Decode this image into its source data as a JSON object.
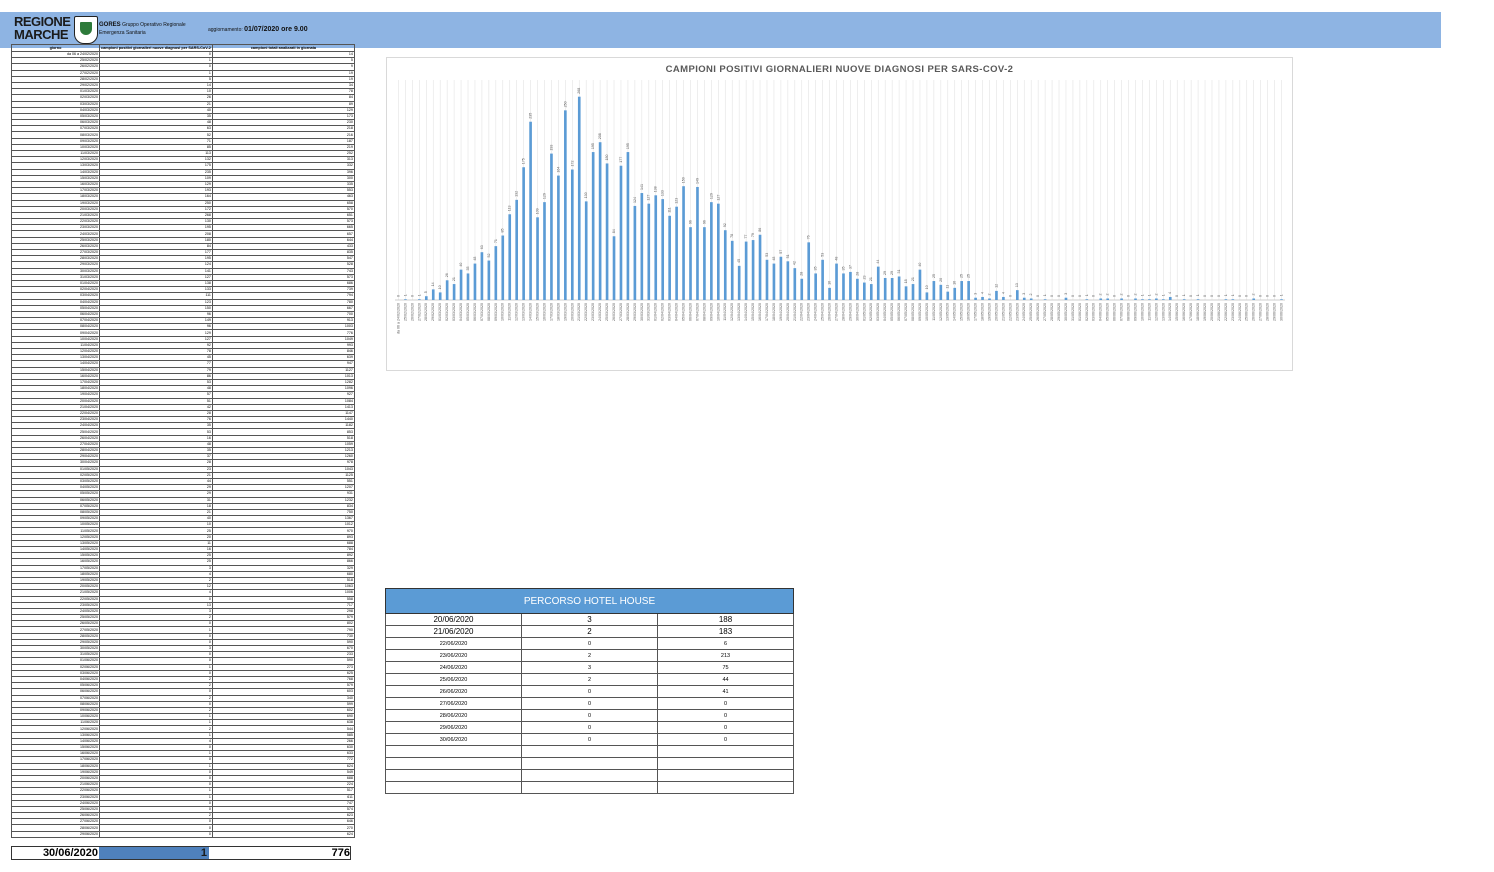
{
  "header": {
    "logo_line1": "REGIONE",
    "logo_line2": "MARCHE",
    "org_name": "GORES",
    "org_desc1": "Gruppo Operativo Regionale",
    "org_desc2": "Emergenza Sanitaria",
    "update_label": "aggiornamento:",
    "update_value": "01/07/2020 ore 9.00"
  },
  "data_table": {
    "columns": [
      "giorno",
      "campioni positivi giornalieri nuove diagnosi per SARS-CoV-2",
      "campioni totali analizzati in giornata"
    ],
    "rows": [
      [
        "da 06 a 24/02/2020",
        "0",
        "14"
      ],
      [
        "25/02/2020",
        "1",
        "5"
      ],
      [
        "26/02/2020",
        "0",
        "9"
      ],
      [
        "27/02/2020",
        "1",
        "19"
      ],
      [
        "28/02/2020",
        "5",
        "19"
      ],
      [
        "29/02/2020",
        "14",
        "34"
      ],
      [
        "01/03/2020",
        "10",
        "78"
      ],
      [
        "02/03/2020",
        "26",
        "84"
      ],
      [
        "03/03/2020",
        "21",
        "89"
      ],
      [
        "04/03/2020",
        "40",
        "129"
      ],
      [
        "05/03/2020",
        "35",
        "173"
      ],
      [
        "06/03/2020",
        "48",
        "230"
      ],
      [
        "07/03/2020",
        "63",
        "218"
      ],
      [
        "08/03/2020",
        "52",
        "216"
      ],
      [
        "09/03/2020",
        "71",
        "187"
      ],
      [
        "10/03/2020",
        "85",
        "219"
      ],
      [
        "11/03/2020",
        "113",
        "252"
      ],
      [
        "12/03/2020",
        "132",
        "313"
      ],
      [
        "13/03/2020",
        "175",
        "332"
      ],
      [
        "14/03/2020",
        "235",
        "396"
      ],
      [
        "15/03/2020",
        "109",
        "300"
      ],
      [
        "16/03/2020",
        "129",
        "335"
      ],
      [
        "17/03/2020",
        "193",
        "553"
      ],
      [
        "18/03/2020",
        "164",
        "463"
      ],
      [
        "19/03/2020",
        "250",
        "658"
      ],
      [
        "20/03/2020",
        "172",
        "570"
      ],
      [
        "21/03/2020",
        "268",
        "651"
      ],
      [
        "22/03/2020",
        "130",
        "573"
      ],
      [
        "23/03/2020",
        "195",
        "665"
      ],
      [
        "24/03/2020",
        "208",
        "657"
      ],
      [
        "25/03/2020",
        "180",
        "644"
      ],
      [
        "26/03/2020",
        "84",
        "433"
      ],
      [
        "27/03/2020",
        "177",
        "835"
      ],
      [
        "28/03/2020",
        "195",
        "547"
      ],
      [
        "29/03/2020",
        "124",
        "528"
      ],
      [
        "30/03/2020",
        "141",
        "743"
      ],
      [
        "31/03/2020",
        "127",
        "573"
      ],
      [
        "01/04/2020",
        "138",
        "686"
      ],
      [
        "02/04/2020",
        "133",
        "739"
      ],
      [
        "03/04/2020",
        "111",
        "794"
      ],
      [
        "04/04/2020",
        "123",
        "780"
      ],
      [
        "05/04/2020",
        "150",
        "667"
      ],
      [
        "06/04/2020",
        "96",
        "700"
      ],
      [
        "07/04/2020",
        "149",
        "913"
      ],
      [
        "08/04/2020",
        "96",
        "1003"
      ],
      [
        "09/04/2020",
        "129",
        "776"
      ],
      [
        "10/04/2020",
        "127",
        "1049"
      ],
      [
        "11/04/2020",
        "92",
        "993"
      ],
      [
        "12/04/2020",
        "78",
        "846"
      ],
      [
        "13/04/2020",
        "45",
        "639"
      ],
      [
        "14/04/2020",
        "77",
        "947"
      ],
      [
        "15/04/2020",
        "79",
        "1127"
      ],
      [
        "16/04/2020",
        "86",
        "1013"
      ],
      [
        "17/04/2020",
        "53",
        "1282"
      ],
      [
        "18/04/2020",
        "48",
        "1096"
      ],
      [
        "19/04/2020",
        "57",
        "927"
      ],
      [
        "20/04/2020",
        "51",
        "1084"
      ],
      [
        "21/04/2020",
        "42",
        "1413"
      ],
      [
        "22/04/2020",
        "28",
        "1147"
      ],
      [
        "23/04/2020",
        "76",
        "1440"
      ],
      [
        "24/04/2020",
        "35",
        "1182"
      ],
      [
        "25/04/2020",
        "53",
        "853"
      ],
      [
        "26/04/2020",
        "16",
        "518"
      ],
      [
        "27/04/2020",
        "48",
        "1059"
      ],
      [
        "28/04/2020",
        "35",
        "1213"
      ],
      [
        "29/04/2020",
        "37",
        "1260"
      ],
      [
        "30/04/2020",
        "28",
        "978"
      ],
      [
        "01/05/2020",
        "23",
        "1043"
      ],
      [
        "02/05/2020",
        "21",
        "1125"
      ],
      [
        "03/05/2020",
        "44",
        "551"
      ],
      [
        "04/05/2020",
        "29",
        "1207"
      ],
      [
        "05/05/2020",
        "29",
        "931"
      ],
      [
        "06/05/2020",
        "31",
        "1232"
      ],
      [
        "07/05/2020",
        "18",
        "834"
      ],
      [
        "08/05/2020",
        "21",
        "750"
      ],
      [
        "09/05/2020",
        "40",
        "1367"
      ],
      [
        "10/05/2020",
        "10",
        "1012"
      ],
      [
        "11/05/2020",
        "25",
        "970"
      ],
      [
        "12/05/2020",
        "20",
        "893"
      ],
      [
        "13/05/2020",
        "11",
        "688"
      ],
      [
        "14/05/2020",
        "16",
        "784"
      ],
      [
        "15/05/2020",
        "25",
        "892"
      ],
      [
        "16/05/2020",
        "25",
        "866"
      ],
      [
        "17/05/2020",
        "3",
        "329"
      ],
      [
        "18/05/2020",
        "4",
        "680"
      ],
      [
        "19/05/2020",
        "2",
        "518"
      ],
      [
        "20/05/2020",
        "12",
        "1063"
      ],
      [
        "21/05/2020",
        "4",
        "1006"
      ],
      [
        "22/05/2020",
        "0",
        "558"
      ],
      [
        "23/05/2020",
        "13",
        "717"
      ],
      [
        "24/05/2020",
        "3",
        "298"
      ],
      [
        "25/05/2020",
        "2",
        "579"
      ],
      [
        "26/05/2020",
        "0",
        "802"
      ],
      [
        "27/05/2020",
        "1",
        "790"
      ],
      [
        "28/05/2020",
        "0",
        "730"
      ],
      [
        "29/05/2020",
        "0",
        "590"
      ],
      [
        "30/05/2020",
        "3",
        "670"
      ],
      [
        "31/05/2020",
        "0",
        "233"
      ],
      [
        "01/06/2020",
        "0",
        "590"
      ],
      [
        "02/06/2020",
        "1",
        "273"
      ],
      [
        "03/06/2020",
        "0",
        "625"
      ],
      [
        "04/06/2020",
        "2",
        "768"
      ],
      [
        "05/06/2020",
        "2",
        "579"
      ],
      [
        "06/06/2020",
        "0",
        "603"
      ],
      [
        "07/06/2020",
        "2",
        "340"
      ],
      [
        "08/06/2020",
        "0",
        "599"
      ],
      [
        "09/06/2020",
        "2",
        "602"
      ],
      [
        "10/06/2020",
        "1",
        "690"
      ],
      [
        "11/06/2020",
        "1",
        "638"
      ],
      [
        "12/06/2020",
        "2",
        "544"
      ],
      [
        "13/06/2020",
        "1",
        "585"
      ],
      [
        "14/06/2020",
        "4",
        "266"
      ],
      [
        "15/06/2020",
        "0",
        "630"
      ],
      [
        "16/06/2020",
        "1",
        "633"
      ],
      [
        "17/06/2020",
        "0",
        "772"
      ],
      [
        "18/06/2020",
        "1",
        "624"
      ],
      [
        "19/06/2020",
        "0",
        "549"
      ],
      [
        "20/06/2020",
        "0",
        "688"
      ],
      [
        "21/06/2020",
        "0",
        "224"
      ],
      [
        "22/06/2020",
        "1",
        "517"
      ],
      [
        "23/06/2020",
        "1",
        "611"
      ],
      [
        "24/06/2020",
        "0",
        "747"
      ],
      [
        "25/06/2020",
        "0",
        "574"
      ],
      [
        "26/06/2020",
        "2",
        "623"
      ],
      [
        "27/06/2020",
        "0",
        "646"
      ],
      [
        "28/06/2020",
        "0",
        "270"
      ],
      [
        "29/06/2020",
        "0",
        "624"
      ]
    ],
    "total": {
      "date": "30/06/2020",
      "cases": "1",
      "tests": "776"
    }
  },
  "chart_data": {
    "type": "bar",
    "title": "CAMPIONI POSITIVI GIORNALIERI NUOVE DIAGNOSI PER SARS-COV-2",
    "xlabel": "",
    "ylabel": "",
    "ylim": [
      0,
      290
    ],
    "grid": true,
    "bar_color": "#5b9bd5",
    "gridline_color": "#e3e3e3",
    "categories": [
      "da 06 a 24/02/2020",
      "25/02/2020",
      "26/02/2020",
      "27/02/2020",
      "28/02/2020",
      "29/02/2020",
      "01/03/2020",
      "02/03/2020",
      "03/03/2020",
      "04/03/2020",
      "05/03/2020",
      "06/03/2020",
      "07/03/2020",
      "08/03/2020",
      "09/03/2020",
      "10/03/2020",
      "11/03/2020",
      "12/03/2020",
      "13/03/2020",
      "14/03/2020",
      "15/03/2020",
      "16/03/2020",
      "17/03/2020",
      "18/03/2020",
      "19/03/2020",
      "20/03/2020",
      "21/03/2020",
      "22/03/2020",
      "23/03/2020",
      "24/03/2020",
      "25/03/2020",
      "26/03/2020",
      "27/03/2020",
      "28/03/2020",
      "29/03/2020",
      "30/03/2020",
      "31/03/2020",
      "01/04/2020",
      "02/04/2020",
      "03/04/2020",
      "04/04/2020",
      "05/04/2020",
      "06/04/2020",
      "07/04/2020",
      "08/04/2020",
      "09/04/2020",
      "10/04/2020",
      "11/04/2020",
      "12/04/2020",
      "13/04/2020",
      "14/04/2020",
      "15/04/2020",
      "16/04/2020",
      "17/04/2020",
      "18/04/2020",
      "19/04/2020",
      "20/04/2020",
      "21/04/2020",
      "22/04/2020",
      "23/04/2020",
      "24/04/2020",
      "25/04/2020",
      "26/04/2020",
      "27/04/2020",
      "28/04/2020",
      "29/04/2020",
      "30/04/2020",
      "01/05/2020",
      "02/05/2020",
      "03/05/2020",
      "04/05/2020",
      "05/05/2020",
      "06/05/2020",
      "07/05/2020",
      "08/05/2020",
      "09/05/2020",
      "10/05/2020",
      "11/05/2020",
      "12/05/2020",
      "13/05/2020",
      "14/05/2020",
      "15/05/2020",
      "16/05/2020",
      "17/05/2020",
      "18/05/2020",
      "19/05/2020",
      "20/05/2020",
      "21/05/2020",
      "22/05/2020",
      "23/05/2020",
      "24/05/2020",
      "25/05/2020",
      "26/05/2020",
      "27/05/2020",
      "28/05/2020",
      "29/05/2020",
      "30/05/2020",
      "31/05/2020",
      "01/06/2020",
      "02/06/2020",
      "03/06/2020",
      "04/06/2020",
      "05/06/2020",
      "06/06/2020",
      "07/06/2020",
      "08/06/2020",
      "09/06/2020",
      "10/06/2020",
      "11/06/2020",
      "12/06/2020",
      "13/06/2020",
      "14/06/2020",
      "15/06/2020",
      "16/06/2020",
      "17/06/2020",
      "18/06/2020",
      "19/06/2020",
      "20/06/2020",
      "21/06/2020",
      "22/06/2020",
      "23/06/2020",
      "24/06/2020",
      "25/06/2020",
      "26/06/2020",
      "27/06/2020",
      "28/06/2020",
      "29/06/2020",
      "30/06/2020"
    ],
    "values": [
      0,
      1,
      0,
      1,
      5,
      14,
      10,
      26,
      21,
      40,
      35,
      48,
      63,
      52,
      71,
      85,
      113,
      132,
      175,
      235,
      109,
      129,
      193,
      164,
      250,
      172,
      268,
      130,
      195,
      208,
      180,
      84,
      177,
      195,
      124,
      141,
      127,
      138,
      133,
      111,
      123,
      150,
      96,
      149,
      96,
      129,
      127,
      92,
      78,
      45,
      77,
      79,
      86,
      53,
      48,
      57,
      51,
      42,
      28,
      76,
      35,
      53,
      16,
      48,
      35,
      37,
      28,
      23,
      21,
      44,
      29,
      29,
      31,
      18,
      21,
      40,
      10,
      25,
      20,
      11,
      16,
      25,
      25,
      3,
      4,
      2,
      12,
      4,
      0,
      13,
      3,
      2,
      0,
      1,
      0,
      0,
      3,
      0,
      0,
      1,
      0,
      2,
      2,
      0,
      2,
      0,
      2,
      1,
      1,
      2,
      1,
      4,
      0,
      1,
      0,
      1,
      0,
      0,
      0,
      1,
      1,
      0,
      0,
      2,
      0,
      0,
      0,
      1
    ]
  },
  "hotel_table": {
    "title": "PERCORSO HOTEL HOUSE",
    "rows": [
      [
        "20/06/2020",
        "3",
        "188"
      ],
      [
        "21/06/2020",
        "2",
        "183"
      ],
      [
        "22/06/2020",
        "0",
        "6"
      ],
      [
        "23/06/2020",
        "2",
        "213"
      ],
      [
        "24/06/2020",
        "3",
        "75"
      ],
      [
        "25/06/2020",
        "2",
        "44"
      ],
      [
        "26/06/2020",
        "0",
        "41"
      ],
      [
        "27/06/2020",
        "0",
        "0"
      ],
      [
        "28/06/2020",
        "0",
        "0"
      ],
      [
        "29/06/2020",
        "0",
        "0"
      ],
      [
        "30/06/2020",
        "0",
        "0"
      ],
      [
        "",
        "",
        ""
      ],
      [
        "",
        "",
        ""
      ],
      [
        "",
        "",
        ""
      ],
      [
        "",
        "",
        ""
      ]
    ]
  }
}
